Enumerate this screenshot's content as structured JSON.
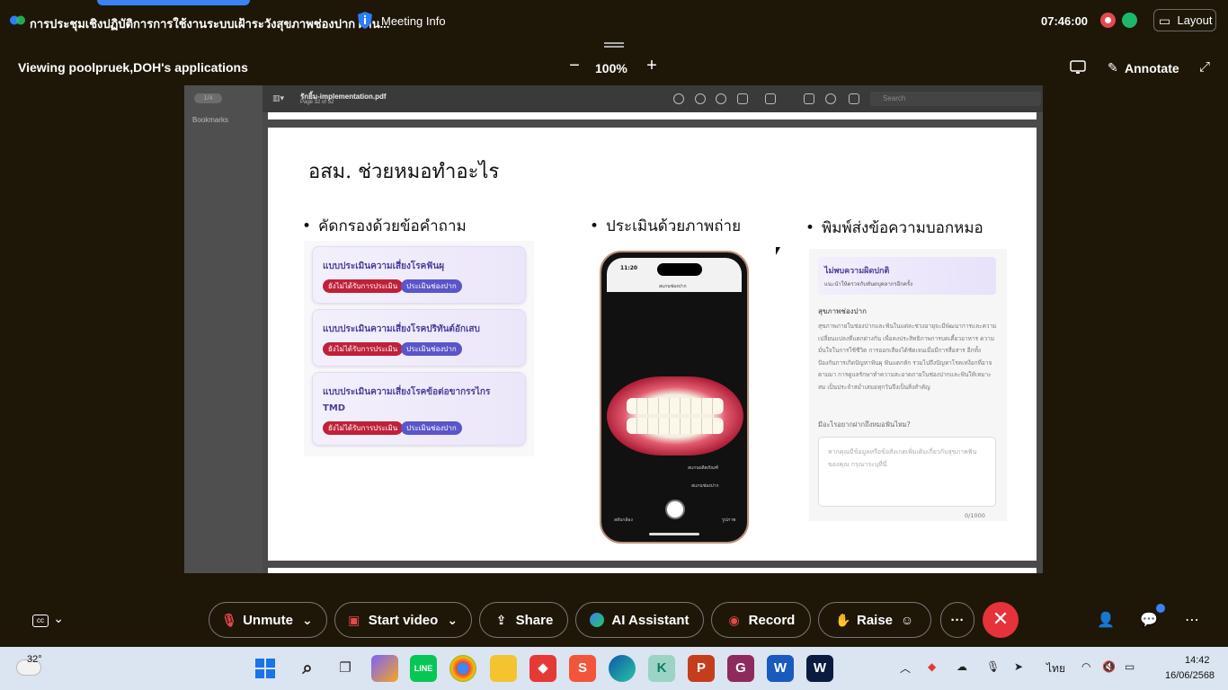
{
  "topbar": {
    "meeting_title": "การประชุมเชิงปฏิบัติการการใช้งานระบบเฝ้าระวังสุขภาพช่องปาก ผ่าน...",
    "meeting_info": "Meeting Info",
    "time": "07:46:00",
    "layout_label": "Layout"
  },
  "viewbar": {
    "viewing_text": "Viewing poolpruek,DOH's applications",
    "zoom_minus": "−",
    "zoom": "100%",
    "zoom_plus": "+",
    "annotate_label": "Annotate"
  },
  "pdf": {
    "sidebar_pill": "1/4",
    "bookmarks_label": "Bookmarks",
    "filename": "รักยิ้ม-implementation.pdf",
    "page_info": "Page 32 of 52",
    "search_placeholder": "Search"
  },
  "slide": {
    "title": "อสม. ช่วยหมอทำอะไร",
    "bullets": [
      "คัดกรองด้วยข้อคำถาม",
      "ประเมินด้วยภาพถ่าย",
      "พิมพ์ส่งข้อความบอกหมอ"
    ],
    "cards": [
      {
        "title": "แบบประเมินความเสี่ยงโรคฟันผุ",
        "tag_red": "ยังไม่ได้รับการประเมิน",
        "tag_blue": "ประเมินช่องปาก"
      },
      {
        "title": "แบบประเมินความเสี่ยงโรคปริทันต์อักเสบ",
        "tag_red": "ยังไม่ได้รับการประเมิน",
        "tag_blue": "ประเมินช่องปาก"
      },
      {
        "title": "แบบประเมินความเสี่ยงโรคข้อต่อขากรรไกร TMD",
        "tag_red": "ยังไม่ได้รับการประเมิน",
        "tag_blue": "ประเมินช่องปาก"
      }
    ],
    "phone": {
      "time": "11:20",
      "nav_title": "สแกนช่องปาก",
      "label_1": "สแกนผลิตภัณฑ์",
      "label_2": "สแกนช่องปาก",
      "label_left": "สลับกล้อง",
      "label_right": "รูปภาพ"
    },
    "message": {
      "alert_title": "ไม่พบความผิดปกติ",
      "alert_sub": "แนะนำให้ตรวจกับทันตบุคลากรอีกครั้ง",
      "heading": "สุขภาพช่องปาก",
      "body": "สุขภาพภายในช่องปากและฟันในแต่ละช่วงอายุจะมีพัฒนาการและความเปลี่ยนแปลงที่แตกต่างกัน เพื่อคงประสิทธิภาพการบดเคี้ยวอาหาร ความมั่นใจในการใช้ชีวิต การออกเสียงได้ชัดเจนเมื่อมีการสื่อสาร อีกทั้งป้องกันการเกิดปัญหาฟันผุ ฟันแตกหัก รวมไปถึงปัญหาโรคเหงือกที่อาจตามมา การดูแลรักษาทำความสะอาดภายในช่องปากและฟันให้เหมาะสม เป็นประจำสม่ำเสมอทุกวันจึงเป็นสิ่งสำคัญ",
      "question": "มีอะไรอยากฝากถึงหมอฟันไหม?",
      "input_placeholder": "หากคุณมีข้อมูลหรือข้อสังเกตเพิ่มเติมเกี่ยวกับสุขภาพฟันของคุณ กรุณาระบุที่นี่",
      "counter": "0/1000"
    }
  },
  "controls": {
    "unmute": "Unmute",
    "start_video": "Start video",
    "share": "Share",
    "ai_assistant": "AI Assistant",
    "record": "Record",
    "raise": "Raise",
    "more": "···",
    "end": "✕"
  },
  "taskbar": {
    "temperature": "32°",
    "lang": "ไทย",
    "time": "14:42",
    "date": "16/06/2568"
  },
  "colors": {
    "background": "#1e1708",
    "end_call": "#e5323b",
    "accent": "#3b82f6",
    "tag_red": "#c0203a",
    "tag_blue": "#5a55c8"
  }
}
